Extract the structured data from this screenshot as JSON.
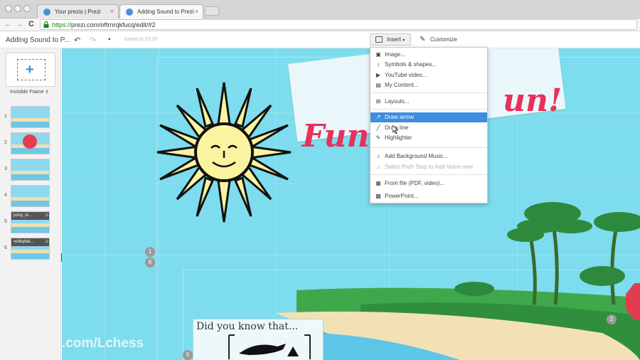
{
  "browser": {
    "tabs": [
      {
        "title": "Your prezis | Prezi",
        "close": "×"
      },
      {
        "title": "Adding Sound to Prezi",
        "close": "×"
      }
    ],
    "nav": {
      "back": "←",
      "forward": "→",
      "reload": "C"
    },
    "url": {
      "scheme": "https://",
      "rest": "prezi.com/oftrnrqkfucq/edit/#2"
    }
  },
  "header": {
    "title": "Adding Sound to P...",
    "saved": "Saved at 15:39",
    "insert_label": "Insert",
    "insert_caret": "▾",
    "customize_label": "Customize"
  },
  "sidebar": {
    "frame_label": "Invisible Frame",
    "frame_caret": "⇕",
    "slides": [
      {
        "num": "1",
        "header": ""
      },
      {
        "num": "2",
        "header": ""
      },
      {
        "num": "3",
        "header": ""
      },
      {
        "num": "4",
        "header": ""
      },
      {
        "num": "5",
        "header": "jump_in..."
      },
      {
        "num": "6",
        "header": "volleybal..."
      }
    ]
  },
  "menu": {
    "items": [
      {
        "label": "Image...",
        "icon": "image-icon",
        "glyph": "▣"
      },
      {
        "label": "Symbols & shapes...",
        "icon": "bulb-icon",
        "glyph": "♁"
      },
      {
        "label": "YouTube video...",
        "icon": "youtube-icon",
        "glyph": "▶"
      },
      {
        "label": "My Content...",
        "icon": "content-icon",
        "glyph": "▤"
      },
      {
        "label": "Layouts...",
        "icon": "layouts-icon",
        "glyph": "⊞"
      },
      {
        "label": "Draw arrow",
        "icon": "arrow-icon",
        "glyph": "↗"
      },
      {
        "label": "Draw line",
        "icon": "line-icon",
        "glyph": "╱"
      },
      {
        "label": "Highlighter",
        "icon": "highlighter-icon",
        "glyph": "✎"
      },
      {
        "label": "Add Background Music...",
        "icon": "music-icon",
        "glyph": "♪"
      },
      {
        "label": "Select Path Step to Add Voice-over",
        "icon": "note-icon",
        "glyph": "♫"
      },
      {
        "label": "From file (PDF, video)...",
        "icon": "file-icon",
        "glyph": "▦"
      },
      {
        "label": "PowerPoint...",
        "icon": "powerpoint-icon",
        "glyph": "▩"
      }
    ]
  },
  "canvas": {
    "banner_left": "Fun",
    "banner_right": "un!",
    "did_you_know": "Did you know that...",
    "badges": [
      "1",
      "6",
      "5",
      "2"
    ],
    "watermark": ".com/Lchess"
  },
  "colors": {
    "ocean": "#7ddcee",
    "accent": "#e8305a",
    "menu_highlight": "#3d8ee0"
  }
}
